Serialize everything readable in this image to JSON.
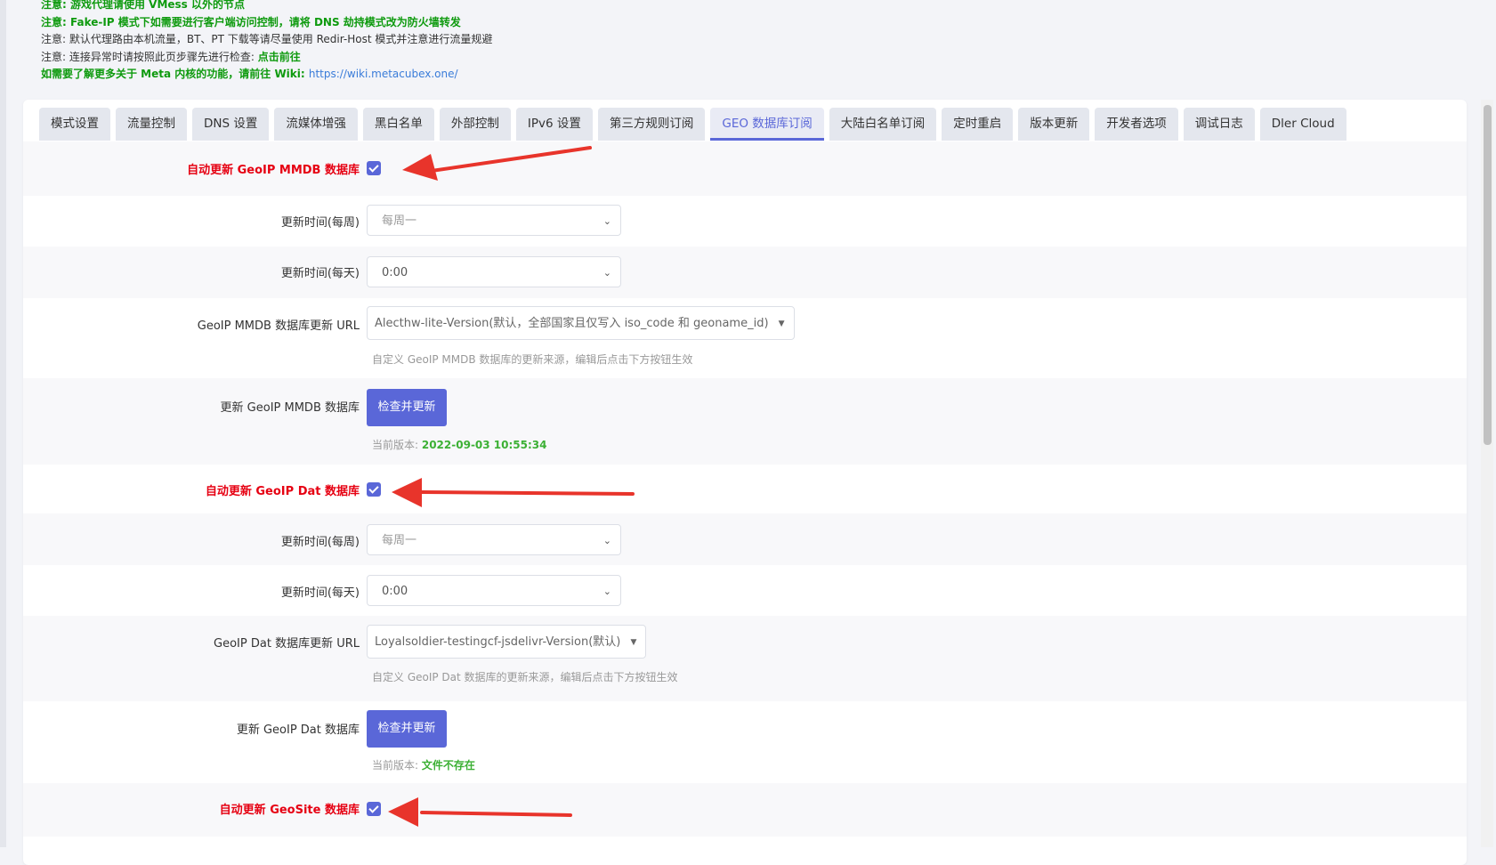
{
  "notices": {
    "line1": "注意: 游戏代理请使用 VMess 以外的节点",
    "line2": "注意: Fake-IP 模式下如需要进行客户端访问控制，请将 DNS 劫持模式改为防火墙转发",
    "line3": "注意: 默认代理路由本机流量，BT、PT 下载等请尽量使用 Redir-Host 模式并注意进行流量规避",
    "line4_prefix": "注意: 连接异常时请按照此页步骤先进行检查: ",
    "line4_link": "点击前往",
    "line5_prefix": "如需要了解更多关于 Meta 内核的功能，请前往 Wiki: ",
    "line5_link": "https://wiki.metacubex.one/"
  },
  "tabs": [
    "模式设置",
    "流量控制",
    "DNS 设置",
    "流媒体增强",
    "黑白名单",
    "外部控制",
    "IPv6 设置",
    "第三方规则订阅",
    "GEO 数据库订阅",
    "大陆白名单订阅",
    "定时重启",
    "版本更新",
    "开发者选项",
    "调试日志",
    "Dler Cloud"
  ],
  "active_tab": "GEO 数据库订阅",
  "mmdb": {
    "auto_label": "自动更新 GeoIP MMDB 数据库",
    "auto_checked": true,
    "week_label": "更新时间(每周)",
    "week_value": "每周一",
    "day_label": "更新时间(每天)",
    "day_value": "0:00",
    "url_label": "GeoIP MMDB 数据库更新 URL",
    "url_value": "Alecthw-lite-Version(默认，全部国家且仅写入 iso_code 和 geoname_id)",
    "url_hint": "自定义 GeoIP MMDB 数据库的更新来源，编辑后点击下方按钮生效",
    "update_label": "更新 GeoIP MMDB 数据库",
    "button": "检查并更新",
    "version_prefix": "当前版本: ",
    "version_value": "2022-09-03 10:55:34"
  },
  "dat": {
    "auto_label": "自动更新 GeoIP Dat 数据库",
    "auto_checked": true,
    "week_label": "更新时间(每周)",
    "week_value": "每周一",
    "day_label": "更新时间(每天)",
    "day_value": "0:00",
    "url_label": "GeoIP Dat 数据库更新 URL",
    "url_value": "Loyalsoldier-testingcf-jsdelivr-Version(默认)",
    "url_hint": "自定义 GeoIP Dat 数据库的更新来源，编辑后点击下方按钮生效",
    "update_label": "更新 GeoIP Dat 数据库",
    "button": "检查并更新",
    "version_prefix": "当前版本: ",
    "version_value": "文件不存在"
  },
  "geosite": {
    "auto_label": "自动更新 GeoSite 数据库",
    "auto_checked": true
  },
  "colors": {
    "accent": "#5a67d8",
    "label_red": "#e60012",
    "notice_green": "#0e9a0e",
    "arrow": "#e8342b"
  }
}
